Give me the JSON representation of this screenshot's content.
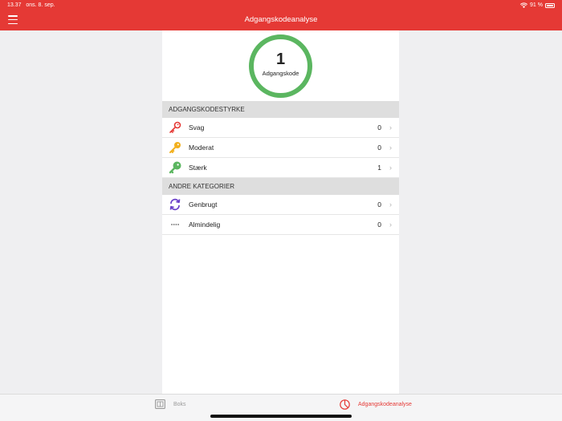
{
  "status_bar": {
    "time": "13.37",
    "date": "ons. 8. sep.",
    "battery": "91 %"
  },
  "nav": {
    "title": "Adgangskodeanalyse"
  },
  "gauge": {
    "count": "1",
    "label": "Adgangskode",
    "color": "#5bb660"
  },
  "sections": [
    {
      "header": "ADGANGSKODESTYRKE",
      "rows": [
        {
          "icon": "key-red-icon",
          "label": "Svag",
          "count": "0"
        },
        {
          "icon": "key-yellow-icon",
          "label": "Moderat",
          "count": "0"
        },
        {
          "icon": "key-green-icon",
          "label": "Stærk",
          "count": "1"
        }
      ]
    },
    {
      "header": "ANDRE KATEGORIER",
      "rows": [
        {
          "icon": "reuse-arrows-icon",
          "label": "Genbrugt",
          "count": "0"
        },
        {
          "icon": "dots-icon",
          "label": "Almindelig",
          "count": "0"
        }
      ]
    }
  ],
  "tabbar": {
    "items": [
      {
        "icon": "vault-icon",
        "label": "Boks",
        "active": false
      },
      {
        "icon": "analysis-icon",
        "label": "Adgangskodeanalyse",
        "active": true
      }
    ]
  },
  "colors": {
    "accent": "#e53935",
    "weak": "#e53935",
    "moderate": "#f2b01e",
    "strong": "#5bb660",
    "reused": "#6a3fc9"
  }
}
